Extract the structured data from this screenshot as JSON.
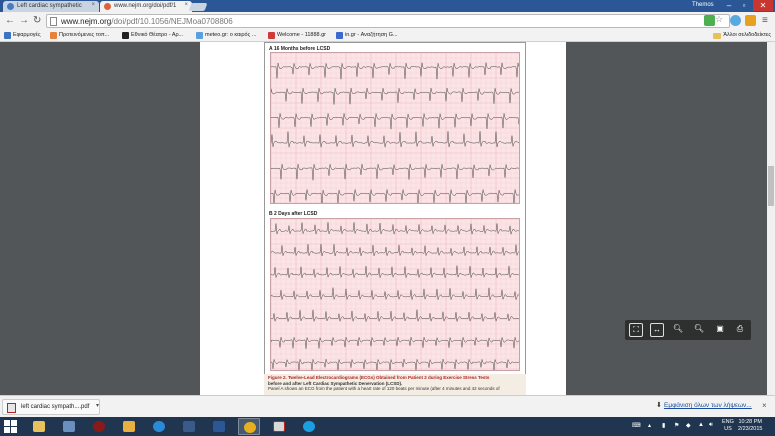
{
  "browser": {
    "tabs": [
      {
        "title": "Left cardiac sympathetic",
        "active": false,
        "favicon_color": "#4a7bc0"
      },
      {
        "title": "www.nejm.org/doi/pdf/1",
        "active": true,
        "favicon_color": "#e0613a"
      }
    ],
    "profile_name": "Themos",
    "url_host": "www.nejm.org",
    "url_path": "/doi/pdf/10.1056/NEJMoa0708806",
    "bookmarks": [
      {
        "label": "Εφαρμογές",
        "icon_color": "#3a75c4"
      },
      {
        "label": "Προτεινόμενες τοπ...",
        "icon_color": "#e8823a"
      },
      {
        "label": "Εθνικό Θέατρο - Αρ...",
        "icon_color": "#222222"
      },
      {
        "label": "meteo.gr: ο καιρός ...",
        "icon_color": "#5aa0e0"
      },
      {
        "label": "Welcome - 11888.gr",
        "icon_color": "#d23a3a"
      },
      {
        "label": "in.gr - Αναζήτηση G...",
        "icon_color": "#3a6ad0"
      }
    ],
    "other_bookmarks": "Άλλοι σελιδοδείκτες"
  },
  "pdf": {
    "panel_a_label": "A  16 Months before LCSD",
    "panel_b_label": "B  2 Days after LCSD",
    "caption_title": "Figure 2. Twelve-Lead Electrocardiograms (ECGs) Obtained from Patient 2 during Exercise Stress Tests",
    "caption_title_2": "before and after Left Cardiac Sympathetic Denervation (LCSD).",
    "caption_body": "Panel A shows an ECG from the patient with a heart rate of 120 beats per minute (after 4 minutes and 42 seconds of",
    "controls": [
      "fit-page",
      "fit-width",
      "zoom-out",
      "zoom-in",
      "save",
      "print"
    ]
  },
  "downloads": {
    "file": "left cardiac sympath....pdf",
    "show_all": "Εμφάνιση όλων των λήψεων..."
  },
  "taskbar": {
    "lang": "ENG",
    "region": "US",
    "time": "10:28 PM",
    "date": "2/23/2015"
  },
  "colors": {
    "ecg_grid": "#f0b8bf",
    "ecg_bg": "#fbe4e6",
    "ecg_trace": "#333333",
    "caption_red": "#b22222"
  }
}
